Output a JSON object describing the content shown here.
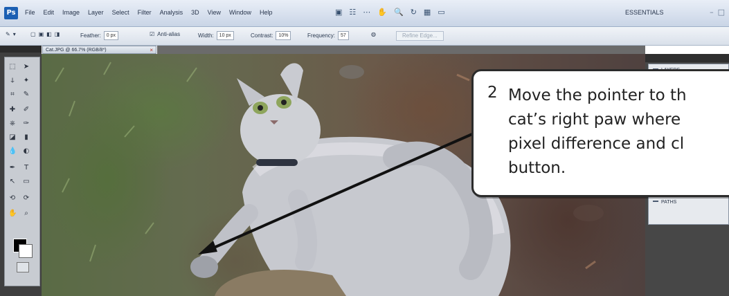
{
  "app": {
    "logo": "Ps",
    "menu": [
      "File",
      "Edit",
      "Image",
      "Layer",
      "Select",
      "Filter",
      "Analysis",
      "3D",
      "View",
      "Window",
      "Help"
    ],
    "workspace": "ESSENTIALS"
  },
  "options_bar": {
    "feather_label": "Feather:",
    "feather_value": "0 px",
    "antialias_label": "Anti-alias",
    "width_label": "Width:",
    "width_value": "10 px",
    "contrast_label": "Contrast:",
    "contrast_value": "10%",
    "frequency_label": "Frequency:",
    "frequency_value": "57",
    "refine_edge": "Refine Edge..."
  },
  "document": {
    "tab_title": "Cat.JPG @ 66.7% (RGB/8*)",
    "photo_subject": "cat"
  },
  "panels": {
    "top": "LAYERS",
    "bottom": "PATHS"
  },
  "callout": {
    "step": "2",
    "lines": [
      "Move the pointer to th",
      "cat’s right paw where",
      "pixel difference and cl",
      "button."
    ]
  },
  "colors": {
    "menubar": "#d6dfec",
    "toolpanel": "#3f3f3f",
    "callout_border": "#2b2b2b",
    "arrow": "#111111"
  },
  "icons": [
    "photoshop-logo",
    "move-icon",
    "marquee-icon",
    "lasso-icon",
    "magic-wand-icon",
    "crop-icon",
    "eyedropper-icon",
    "healing-icon",
    "brush-icon",
    "clone-icon",
    "history-icon",
    "eraser-icon",
    "gradient-icon",
    "blur-icon",
    "dodge-icon",
    "pen-icon",
    "type-icon",
    "path-select-icon",
    "shape-icon",
    "hand-icon",
    "zoom-icon",
    "foreground-color-icon",
    "background-color-icon",
    "quick-mask-icon"
  ]
}
